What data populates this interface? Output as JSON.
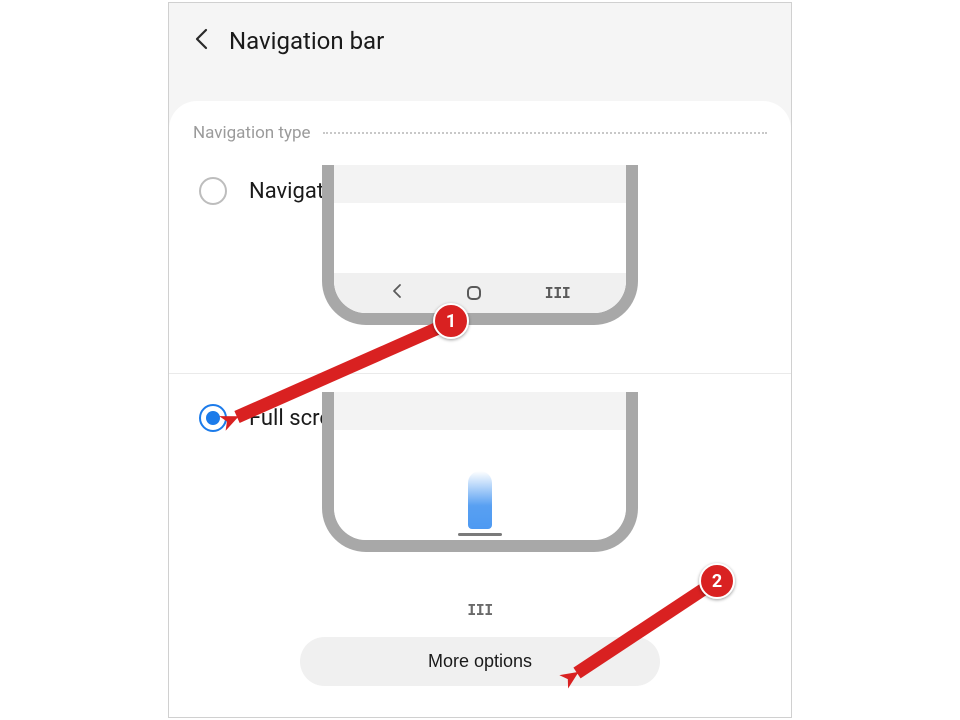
{
  "header": {
    "title": "Navigation bar"
  },
  "section": {
    "label": "Navigation type"
  },
  "option_buttons": {
    "label": "Navigation buttons",
    "selected": false
  },
  "option_gestures": {
    "label": "Full screen gestures",
    "selected": true
  },
  "more_button": {
    "label": "More options"
  },
  "annotations": {
    "badge1": "1",
    "badge2": "2"
  }
}
